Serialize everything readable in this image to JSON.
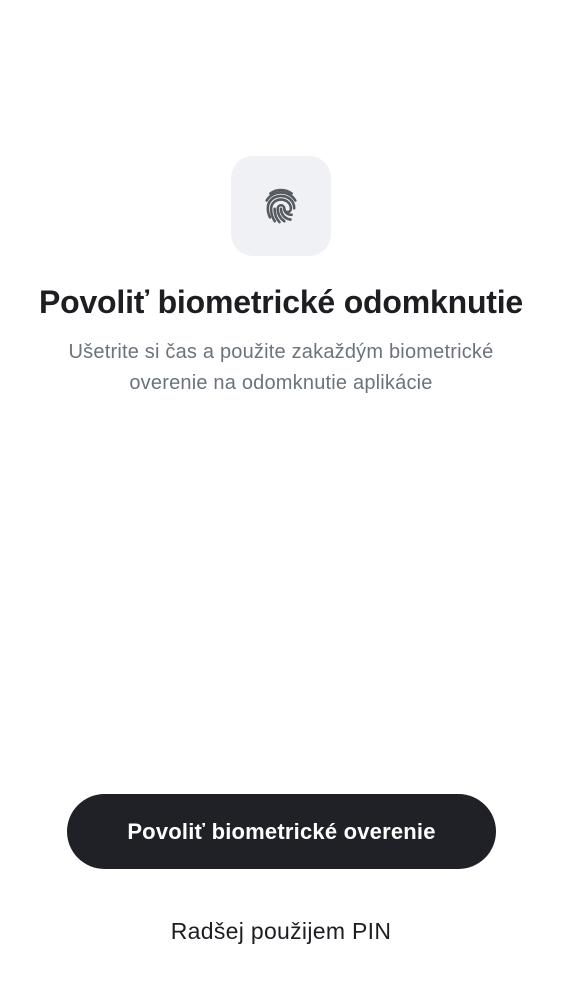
{
  "screen": {
    "icon": "fingerprint-icon",
    "title": "Povoliť biometrické odomknutie",
    "subtitle": "Ušetrite si čas a použite zakaždým biometrické overenie na odomknutie aplikácie"
  },
  "actions": {
    "primary_label": "Povoliť biometrické overenie",
    "secondary_label": "Radšej použijem PIN"
  },
  "colors": {
    "background": "#ffffff",
    "icon_tile": "#eff1f5",
    "primary_button": "#1f2126",
    "title_text": "#1c1e22",
    "subtitle_text": "#6b737d"
  }
}
